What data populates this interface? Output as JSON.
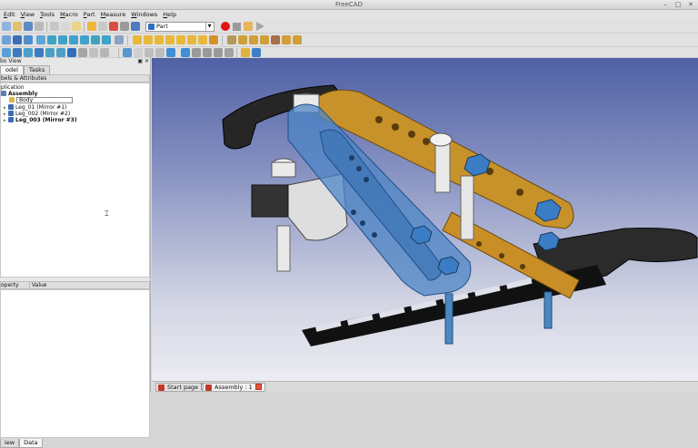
{
  "window": {
    "title": "FreeCAD",
    "controls": [
      "–",
      "□",
      "✕"
    ]
  },
  "menu": [
    "Edit",
    "View",
    "Tools",
    "Macro",
    "Part",
    "Measure",
    "Windows",
    "Help"
  ],
  "workbench": {
    "selected": "Part"
  },
  "combo_view": {
    "title": "bo View",
    "tabs": [
      "odel",
      "Tasks"
    ],
    "header": "bels & Attributes",
    "tree": [
      {
        "label": "plication",
        "level": 0,
        "bold": false,
        "icon": "application-icon"
      },
      {
        "label": "Assembly",
        "level": 1,
        "bold": true,
        "icon": "document-icon"
      },
      {
        "label": "Body",
        "level": 2,
        "bold": false,
        "icon": "body-icon",
        "editing": true
      },
      {
        "label": "Leg_01 (Mirror #1)",
        "level": 2,
        "bold": false,
        "icon": "link-icon"
      },
      {
        "label": "Leg_002 (Mirror #2)",
        "level": 2,
        "bold": false,
        "icon": "link-icon"
      },
      {
        "label": "Leg_003 (Mirror #3)",
        "level": 2,
        "bold": true,
        "icon": "link-icon"
      }
    ],
    "property_columns": [
      "operty",
      "Value"
    ],
    "property_tabs": [
      "iew",
      "Data"
    ]
  },
  "documents": [
    {
      "label": "Start page",
      "active": false
    },
    {
      "label": "Assembly : 1",
      "active": true
    }
  ],
  "colors": {
    "viewport_top": "#4f60a4",
    "viewport_bottom": "#ececf2",
    "blue_part": "#4d86c6",
    "gold_part": "#c8922a",
    "dark_part": "#2a2a2a"
  }
}
